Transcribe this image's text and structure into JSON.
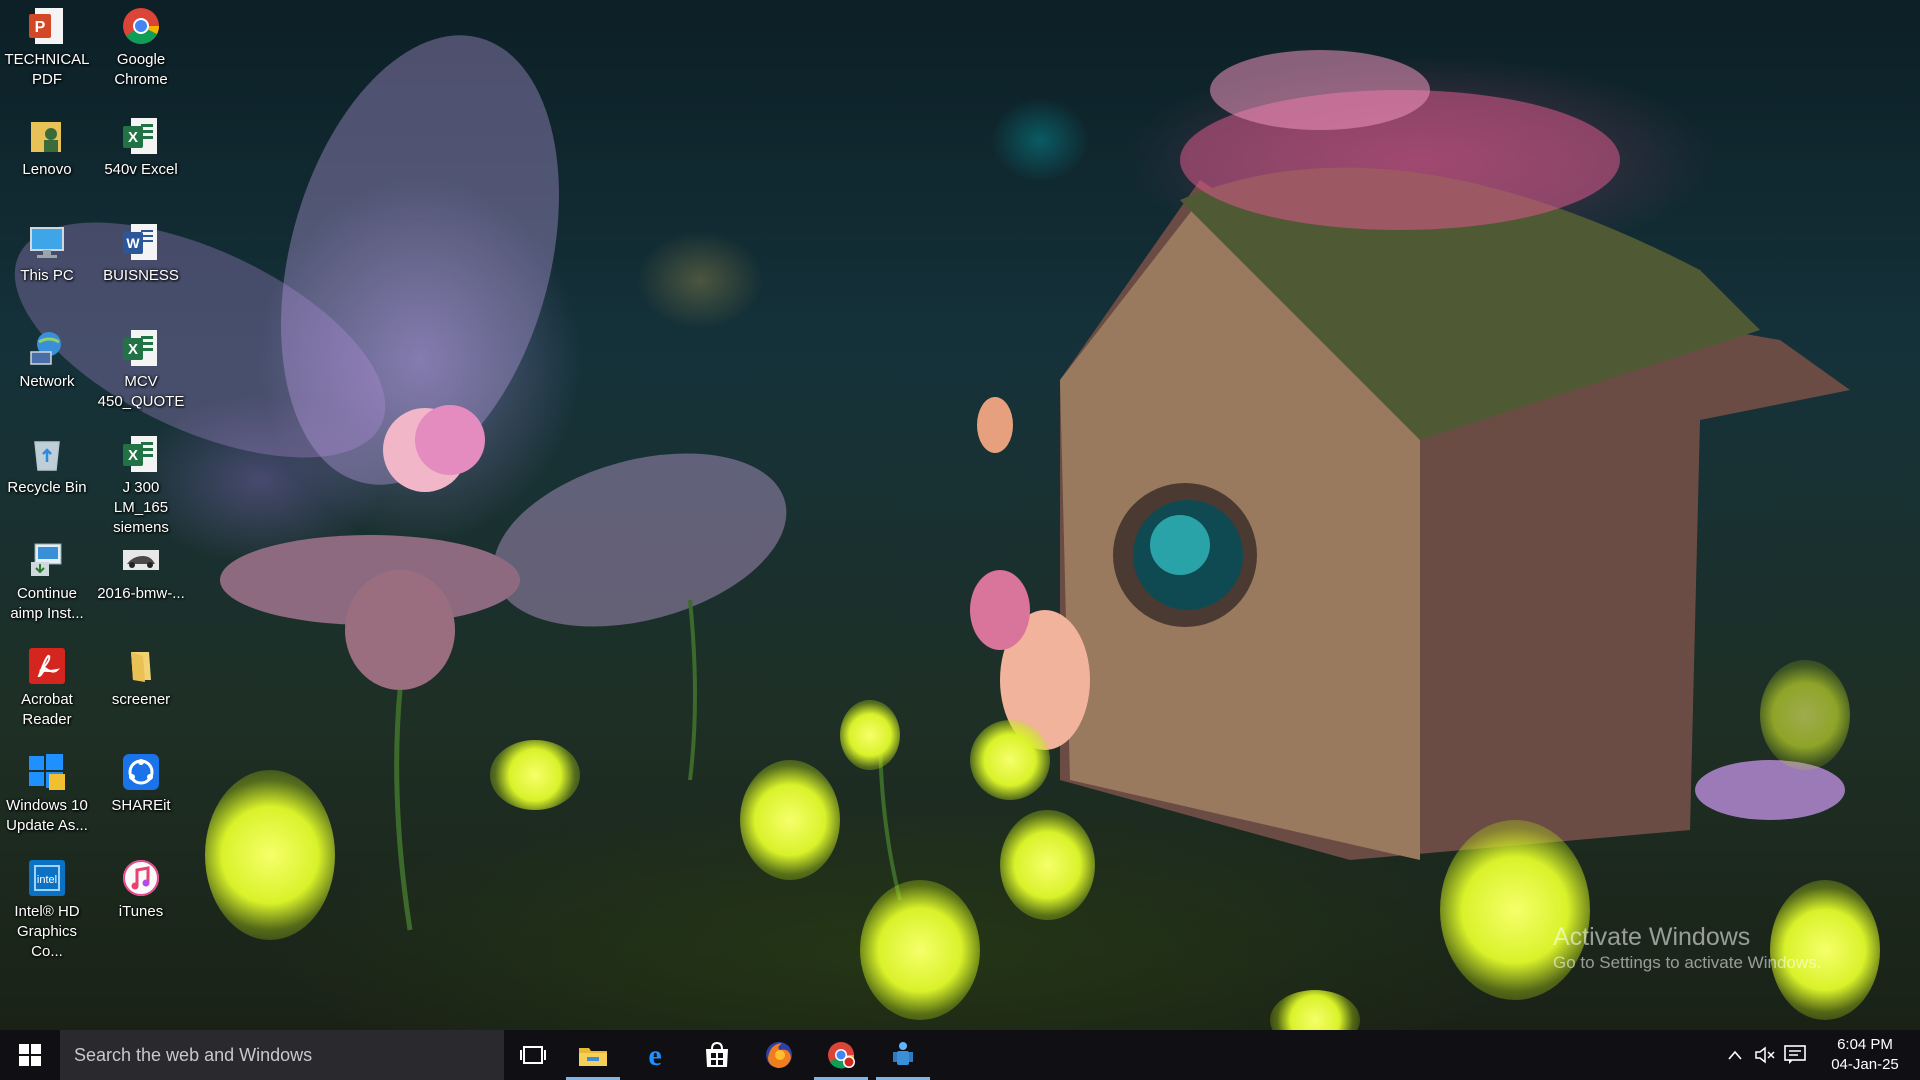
{
  "desktop": {
    "icons": [
      {
        "label": "TECHNICAL PDF",
        "icon": "powerpoint-icon"
      },
      {
        "label": "Google Chrome",
        "icon": "chrome-icon"
      },
      {
        "label": "Lenovo",
        "icon": "user-folder-icon"
      },
      {
        "label": "540v Excel",
        "icon": "excel-icon"
      },
      {
        "label": "This PC",
        "icon": "computer-icon"
      },
      {
        "label": "BUISNESS",
        "icon": "word-icon"
      },
      {
        "label": "Network",
        "icon": "network-icon"
      },
      {
        "label": "MCV 450_QUOTE",
        "icon": "excel-icon"
      },
      {
        "label": "Recycle Bin",
        "icon": "recycle-bin-icon"
      },
      {
        "label": "J 300 LM_165 siemens",
        "icon": "excel-icon"
      },
      {
        "label": "Continue aimp Inst...",
        "icon": "installer-icon"
      },
      {
        "label": "2016-bmw-...",
        "icon": "image-file-icon"
      },
      {
        "label": "Acrobat Reader",
        "icon": "acrobat-icon"
      },
      {
        "label": "screener",
        "icon": "folder-icon"
      },
      {
        "label": "Windows 10 Update As...",
        "icon": "windows-update-icon"
      },
      {
        "label": "SHAREit",
        "icon": "shareit-icon"
      },
      {
        "label": "Intel® HD Graphics Co...",
        "icon": "intel-graphics-icon"
      },
      {
        "label": "iTunes",
        "icon": "itunes-icon"
      }
    ],
    "watermark": {
      "line1": "Activate Windows",
      "line2": "Go to Settings to activate Windows."
    }
  },
  "taskbar": {
    "search_placeholder": "Search the web and Windows",
    "pinned": [
      {
        "name": "task-view-icon"
      },
      {
        "name": "file-explorer-icon",
        "active": true
      },
      {
        "name": "edge-icon"
      },
      {
        "name": "store-icon"
      },
      {
        "name": "firefox-icon"
      },
      {
        "name": "chrome-icon",
        "active": true
      },
      {
        "name": "app-figure-icon",
        "active": true
      }
    ],
    "clock": {
      "time": "6:04 PM",
      "date": "04-Jan-25"
    }
  },
  "colors": {
    "taskbar": "#101014",
    "search": "#2a2a2e",
    "active_indicator": "#7fb4e6"
  }
}
